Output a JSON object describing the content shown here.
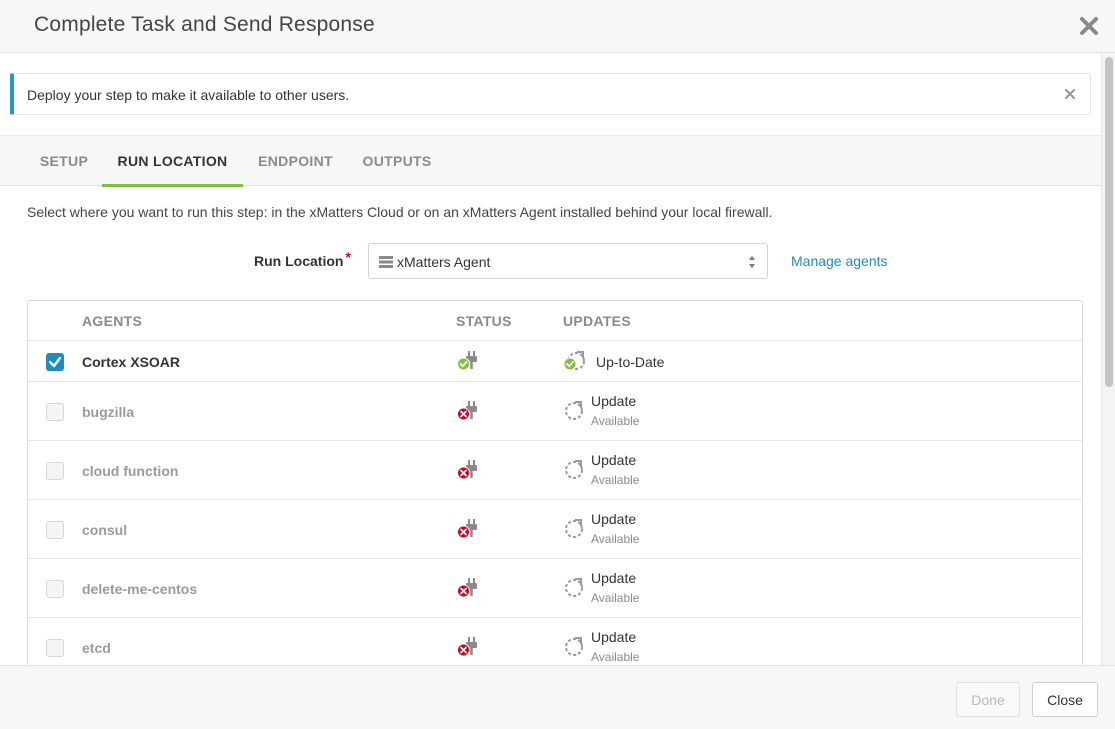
{
  "dialog": {
    "title": "Complete Task and Send Response",
    "close_icon": "close-icon"
  },
  "banner": {
    "message": "Deploy your step to make it available to other users.",
    "accent_color": "#1d9bd1"
  },
  "tabs": [
    {
      "label": "SETUP",
      "active": false
    },
    {
      "label": "RUN LOCATION",
      "active": true
    },
    {
      "label": "ENDPOINT",
      "active": false
    },
    {
      "label": "OUTPUTS",
      "active": false
    }
  ],
  "run_location": {
    "description": "Select where you want to run this step: in the xMatters Cloud or on an xMatters Agent installed behind your local firewall.",
    "label": "Run Location",
    "required_mark": "*",
    "selected": "xMatters Agent",
    "manage_link": "Manage agents"
  },
  "agents_table": {
    "headers": {
      "agents": "AGENTS",
      "status": "STATUS",
      "updates": "UPDATES"
    },
    "rows": [
      {
        "name": "Cortex XSOAR",
        "checked": true,
        "status": "connected",
        "update": "Up-to-Date",
        "update_sub": ""
      },
      {
        "name": "bugzilla",
        "checked": false,
        "status": "disconnected",
        "update": "Update",
        "update_sub": "Available"
      },
      {
        "name": "cloud function",
        "checked": false,
        "status": "disconnected",
        "update": "Update",
        "update_sub": "Available"
      },
      {
        "name": "consul",
        "checked": false,
        "status": "disconnected",
        "update": "Update",
        "update_sub": "Available"
      },
      {
        "name": "delete-me-centos",
        "checked": false,
        "status": "disconnected",
        "update": "Update",
        "update_sub": "Available"
      },
      {
        "name": "etcd",
        "checked": false,
        "status": "disconnected",
        "update": "Update",
        "update_sub": "Available"
      }
    ]
  },
  "footer": {
    "done_label": "Done",
    "close_label": "Close"
  },
  "colors": {
    "accent_blue": "#1d8cc1",
    "tab_underline": "#7fc241",
    "status_ok": "#7fc241",
    "status_error": "#d0021b"
  }
}
